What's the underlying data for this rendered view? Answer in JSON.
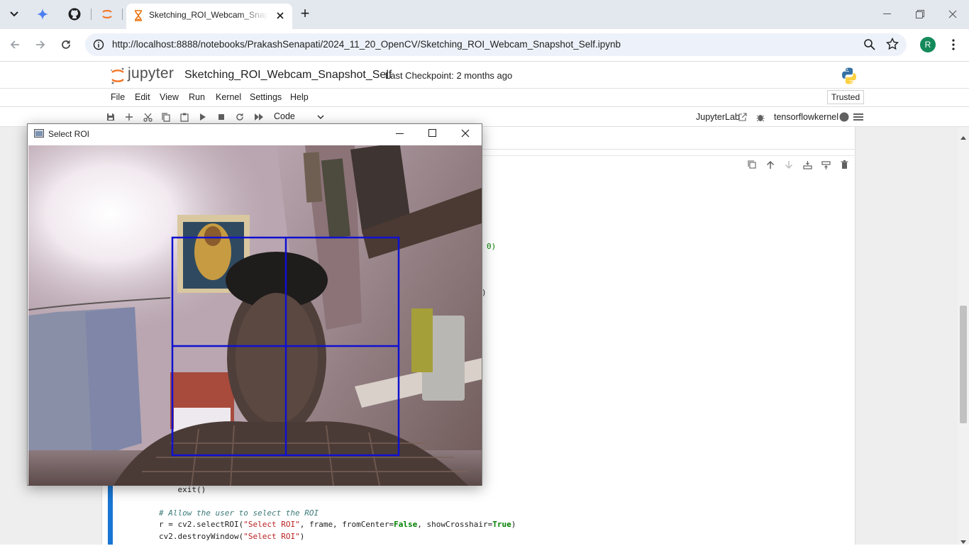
{
  "browser": {
    "tab_title": "Sketching_ROI_Webcam_Snapshot_Self.ipynb",
    "url": "http://localhost:8888/notebooks/PrakashSenapati/2024_11_20_OpenCV/Sketching_ROI_Webcam_Snapshot_Self.ipynb",
    "profile_initial": "R",
    "new_tab_symbol": "+"
  },
  "jupyter": {
    "logo_text": "jupyter",
    "notebook_title": "Sketching_ROI_Webcam_Snapshot_Self",
    "checkpoint": "Last Checkpoint: 2 months ago",
    "menu": [
      "File",
      "Edit",
      "View",
      "Run",
      "Kernel",
      "Settings",
      "Help"
    ],
    "trusted": "Trusted",
    "cell_type": "Code",
    "jupyterlab_link": "JupyterLab",
    "kernel_name": "tensorflowkernel"
  },
  "code": {
    "fragment_1": "0)",
    "fragment_2": ")",
    "line_exit": "    exit()",
    "comment": "# Allow the user to select the ROI",
    "select_prefix": "r = cv2.selectROI(",
    "select_str": "\"Select ROI\"",
    "select_mid1": ", frame, fromCenter=",
    "select_false": "False",
    "select_mid2": ", showCrosshair=",
    "select_true": "True",
    "select_end": ")",
    "destroy_prefix": "cv2.destroyWindow(",
    "destroy_str": "\"Select ROI\"",
    "destroy_end": ")"
  },
  "roi_window": {
    "title": "Select ROI",
    "selection_color": "#1010d0"
  },
  "colors": {
    "accent": "#1976d2",
    "jupyter_orange": "#f37626"
  }
}
